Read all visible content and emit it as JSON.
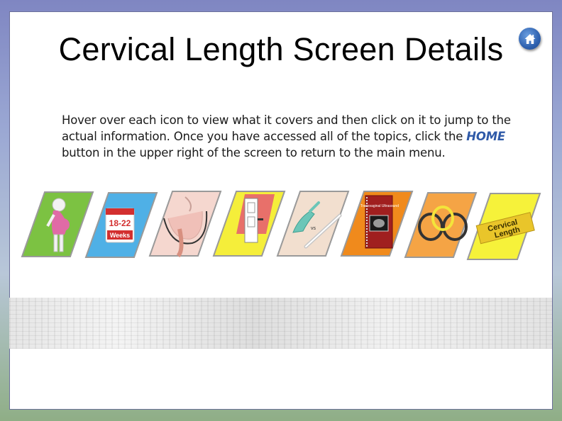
{
  "page": {
    "title": "Cervical Length Screen Details",
    "instructions": {
      "part1": "Hover over each icon to view what it covers and then click on it to jump to the actual information.  Once you have accessed all of the topics, click the ",
      "home_word": "HOME",
      "part2": " button in the upper right of the screen to return to the main menu."
    }
  },
  "home_button": {
    "icon": "home-icon",
    "color": "#2f62b0"
  },
  "topics": [
    {
      "icon": "pregnant-figure-icon",
      "bg": "#7cc242"
    },
    {
      "icon": "calendar-icon",
      "bg": "#4fb0e6",
      "text_top": "18-22",
      "text_bottom": "Weeks"
    },
    {
      "icon": "cervix-anatomy-icon",
      "bg": "#f5d7cf"
    },
    {
      "icon": "open-door-icon",
      "bg": "#f5ee3a"
    },
    {
      "icon": "gloved-hand-vs-probe-icon",
      "bg": "#f2dfcf",
      "text": "vs"
    },
    {
      "icon": "ultrasound-book-icon",
      "bg": "#f08a1c",
      "text": "Transvaginal Ultrasound"
    },
    {
      "icon": "cerclage-rings-icon",
      "bg": "#f5a445"
    },
    {
      "icon": "measuring-tape-icon",
      "bg": "#f6f23a",
      "text_top": "Cervical",
      "text_bottom": "Length"
    }
  ]
}
